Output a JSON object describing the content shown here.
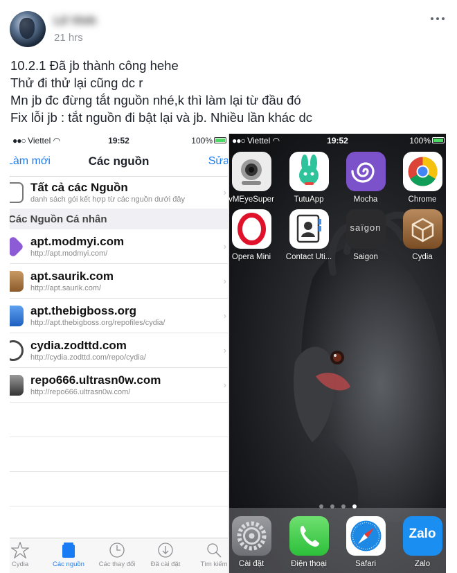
{
  "post": {
    "author": "Lê Vinh",
    "time": "21 hrs",
    "lines": [
      "10.2.1 Đã jb thành công hehe",
      "Thử đi thử lại cũng dc r",
      "Mn jb đc đừng tắt nguồn nhé,k thì làm lại từ đầu đó",
      "Fix lỗi jb : tắt nguồn đi bật lại và jb. Nhiều lần khác dc"
    ]
  },
  "cydia": {
    "status": {
      "carrier": "Viettel",
      "time": "19:52",
      "battery": "100%"
    },
    "nav": {
      "left": "Làm mới",
      "title": "Các nguồn",
      "right": "Sửa"
    },
    "all_sources": {
      "title": "Tất cả các Nguồn",
      "subtitle": "danh sách gói kết hợp từ các nguồn dưới đây"
    },
    "section_title": "Các Nguồn Cá nhân",
    "sources": [
      {
        "name": "apt.modmyi.com",
        "url": "http://apt.modmyi.com/",
        "icon": "modmyi-icon",
        "color": "#8e5bd6"
      },
      {
        "name": "apt.saurik.com",
        "url": "http://apt.saurik.com/",
        "icon": "saurik-icon",
        "color": "#b9844f"
      },
      {
        "name": "apt.thebigboss.org",
        "url": "http://apt.thebigboss.org/repofiles/cydia/",
        "icon": "bigboss-icon",
        "color": "#3b7bd8"
      },
      {
        "name": "cydia.zodttd.com",
        "url": "http://cydia.zodttd.com/repo/cydia/",
        "icon": "zodttd-icon",
        "color": "#444444"
      },
      {
        "name": "repo666.ultrasn0w.com",
        "url": "http://repo666.ultrasn0w.com/",
        "icon": "ultrasn0w-icon",
        "color": "#666666"
      }
    ],
    "tabs": [
      {
        "label": "Cydia",
        "icon": "star-icon",
        "active": false
      },
      {
        "label": "Các nguồn",
        "icon": "sources-icon",
        "active": true
      },
      {
        "label": "Các thay đổi",
        "icon": "clock-icon",
        "active": false
      },
      {
        "label": "Đã cài đặt",
        "icon": "download-icon",
        "active": false
      },
      {
        "label": "Tìm kiếm",
        "icon": "search-icon",
        "active": false
      }
    ]
  },
  "home": {
    "status": {
      "carrier": "Viettel",
      "time": "19:52",
      "battery": "100%"
    },
    "apps": [
      {
        "label": "vMEyeSuper",
        "icon": "camera-icon"
      },
      {
        "label": "TutuApp",
        "icon": "rabbit-icon"
      },
      {
        "label": "Mocha",
        "icon": "spiral-icon"
      },
      {
        "label": "Chrome",
        "icon": "chrome-icon"
      },
      {
        "label": "Opera Mini",
        "icon": "opera-icon"
      },
      {
        "label": "Contact Uti...",
        "icon": "contacts-icon"
      },
      {
        "label": "Saigon",
        "icon": "saigon-icon",
        "icon_text": "saïgon"
      },
      {
        "label": "Cydia",
        "icon": "cydia-icon"
      }
    ],
    "dock": [
      {
        "label": "Cài đặt",
        "icon": "settings-icon"
      },
      {
        "label": "Điện thoại",
        "icon": "phone-icon"
      },
      {
        "label": "Safari",
        "icon": "safari-icon"
      },
      {
        "label": "Zalo",
        "icon": "zalo-icon",
        "icon_text": "Zalo"
      }
    ],
    "pages": 4,
    "current_page": 4
  }
}
